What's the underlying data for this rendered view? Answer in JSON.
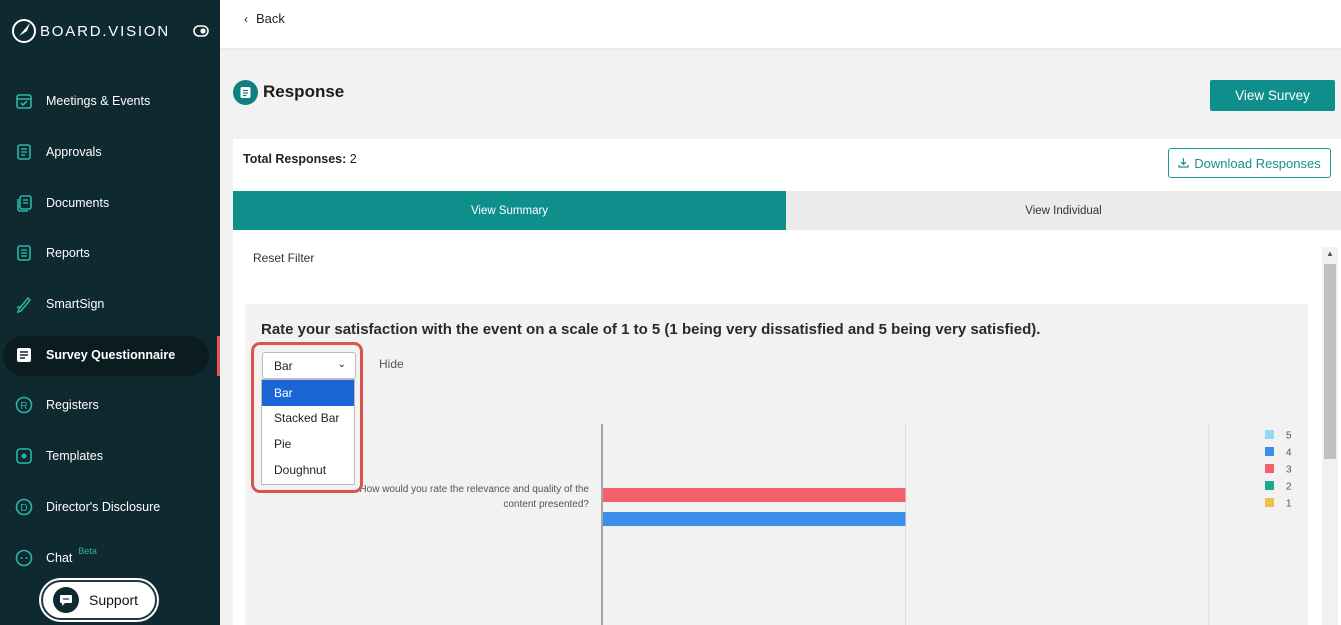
{
  "sidebar": {
    "brand": "BOARD.VISION",
    "items": [
      {
        "label": "Meetings & Events",
        "icon": "calendar-icon"
      },
      {
        "label": "Approvals",
        "icon": "document-check-icon"
      },
      {
        "label": "Documents",
        "icon": "documents-icon"
      },
      {
        "label": "Reports",
        "icon": "report-icon"
      },
      {
        "label": "SmartSign",
        "icon": "pen-icon"
      },
      {
        "label": "Survey Questionnaire",
        "icon": "survey-icon",
        "active": true
      },
      {
        "label": "Registers",
        "icon": "registered-icon"
      },
      {
        "label": "Templates",
        "icon": "template-icon"
      },
      {
        "label": "Director's Disclosure",
        "icon": "disclosure-icon"
      },
      {
        "label": "Chat",
        "icon": "chat-icon",
        "badge": "Beta"
      }
    ],
    "support_label": "Support"
  },
  "topbar": {
    "back_label": "Back"
  },
  "header": {
    "title": "Response",
    "view_survey_label": "View Survey"
  },
  "summary": {
    "total_label": "Total Responses:",
    "total_value": "2",
    "download_label": "Download Responses"
  },
  "tabs": [
    {
      "label": "View Summary",
      "active": true
    },
    {
      "label": "View Individual",
      "active": false
    }
  ],
  "reset_filter_label": "Reset Filter",
  "question": {
    "title": "Rate your satisfaction with the event on a scale of 1 to 5 (1 being very dissatisfied and 5 being very satisfied).",
    "chart_type_selected": "Bar",
    "chart_type_options": [
      "Bar",
      "Stacked Bar",
      "Pie",
      "Doughnut"
    ],
    "hide_label": "Hide"
  },
  "colors": {
    "sidebar_bg": "#0e2a30",
    "accent": "#0f8f8c",
    "highlight": "#d9534f"
  },
  "chart_data": {
    "type": "bar",
    "orientation": "horizontal",
    "categories": [
      "How would you rate the relevance and quality of the content presented?"
    ],
    "series": [
      {
        "name": "5",
        "color": "#8fdcf0",
        "values": [
          0
        ]
      },
      {
        "name": "4",
        "color": "#3b8fe8",
        "values": [
          1
        ]
      },
      {
        "name": "3",
        "color": "#f4606c",
        "values": [
          1
        ]
      },
      {
        "name": "2",
        "color": "#1aaa8e",
        "values": [
          0
        ]
      },
      {
        "name": "1",
        "color": "#f5bd4f",
        "values": [
          0
        ]
      }
    ],
    "xlim": [
      0,
      2
    ],
    "grid": true,
    "legend": "right"
  }
}
